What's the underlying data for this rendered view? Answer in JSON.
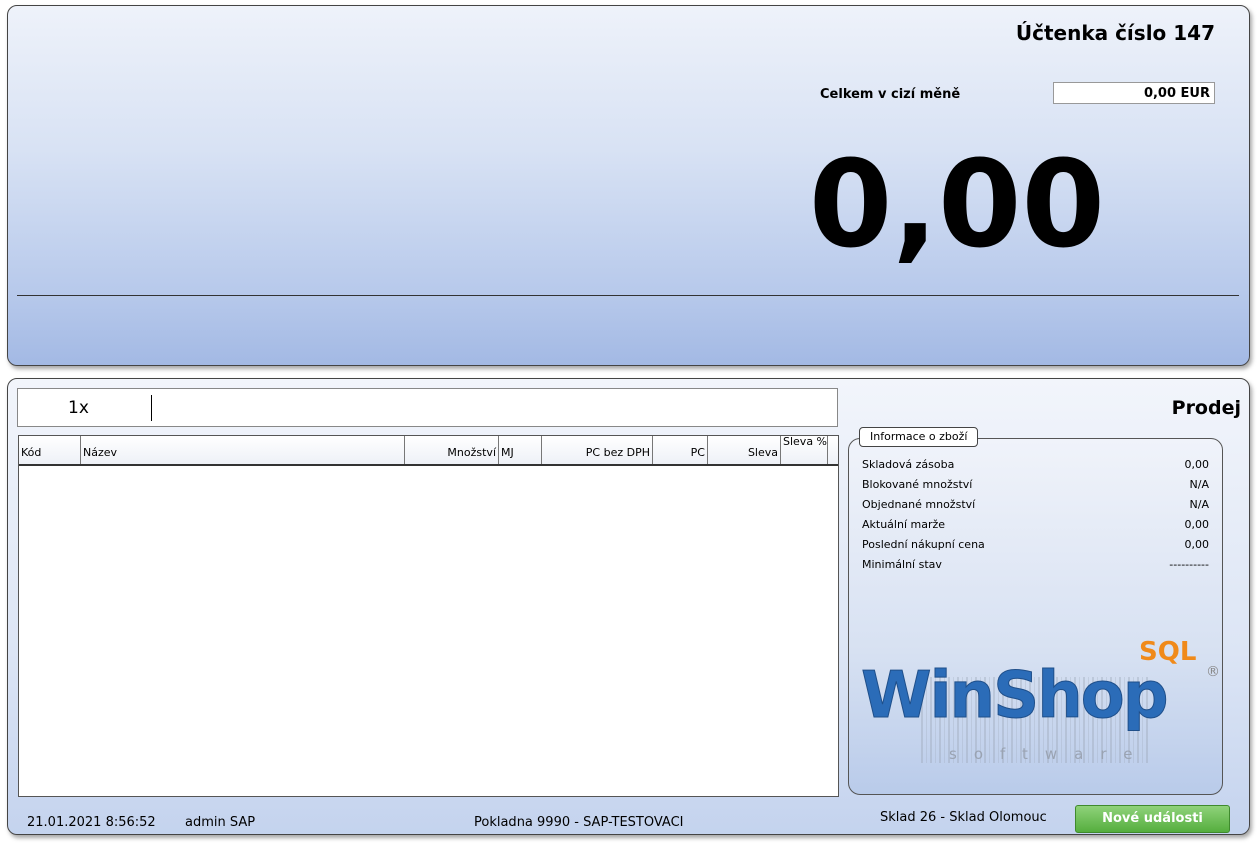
{
  "header": {
    "receipt_title": "Účtenka číslo 147",
    "foreign_currency_label": "Celkem v cizí měně",
    "foreign_currency_value": "0,00 EUR",
    "grand_total": "0,00"
  },
  "entry": {
    "quantity_prefix": "1x"
  },
  "grid": {
    "columns": [
      "Kód",
      "Název",
      "Množství",
      "MJ",
      "PC bez DPH",
      "PC",
      "Sleva",
      "Sleva %"
    ],
    "rows": []
  },
  "mode_title": "Prodej",
  "info": {
    "tab_label": "Informace o zboží",
    "rows": [
      {
        "label": "Skladová zásoba",
        "value": "0,00"
      },
      {
        "label": "Blokované množství",
        "value": "N/A"
      },
      {
        "label": "Objednané množství",
        "value": "N/A"
      },
      {
        "label": "Aktuální marže",
        "value": "0,00"
      },
      {
        "label": "Poslední nákupní cena",
        "value": "0,00"
      },
      {
        "label": "Minimální stav",
        "value": "----------"
      }
    ]
  },
  "logo": {
    "name": "WinShop",
    "edition": "SQL",
    "registered": "®",
    "tagline": "software"
  },
  "status": {
    "datetime": "21.01.2021 8:56:52",
    "user": "admin SAP",
    "register": "Pokladna 9990 - SAP-TESTOVACI",
    "store": "Sklad 26 - Sklad Olomouc",
    "events_button": "Nové události"
  },
  "colors": {
    "panel_blue": "#b7c9eb",
    "events_green": "#55ae3e",
    "logo_blue": "#2b6cb8",
    "logo_orange": "#f08a1a"
  }
}
